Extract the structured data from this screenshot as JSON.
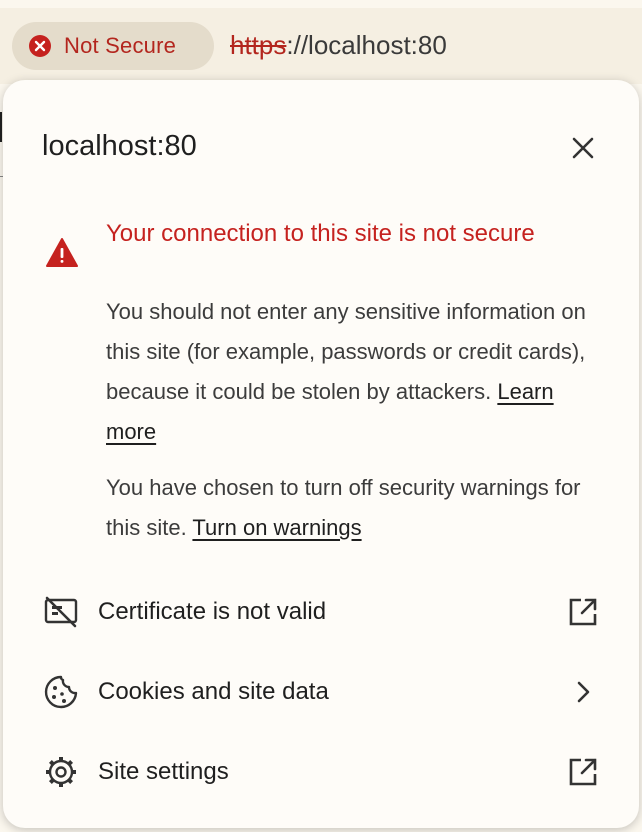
{
  "omnibox": {
    "chip_label": "Not Secure",
    "url_scheme": "https",
    "url_rest": "://localhost:80"
  },
  "popup": {
    "title": "localhost:80",
    "warning": {
      "headline": "Your connection to this site is not secure",
      "body": "You should not enter any sensitive information on this site (for example, passwords or credit cards), because it could be stolen by attackers. ",
      "learn_more": "Learn more",
      "note": "You have chosen to turn off security warnings for this site. ",
      "turn_on": "Turn on warnings"
    },
    "rows": [
      {
        "label": "Certificate is not valid",
        "icon": "certificate-invalid-icon",
        "trailing": "external-link-icon"
      },
      {
        "label": "Cookies and site data",
        "icon": "cookie-icon",
        "trailing": "chevron-right-icon"
      },
      {
        "label": "Site settings",
        "icon": "gear-icon",
        "trailing": "external-link-icon"
      }
    ]
  },
  "colors": {
    "danger": "#c5221f",
    "chip_bg": "#e4dccb",
    "popup_bg": "#fefcf8",
    "text": "#1f1f1f"
  }
}
